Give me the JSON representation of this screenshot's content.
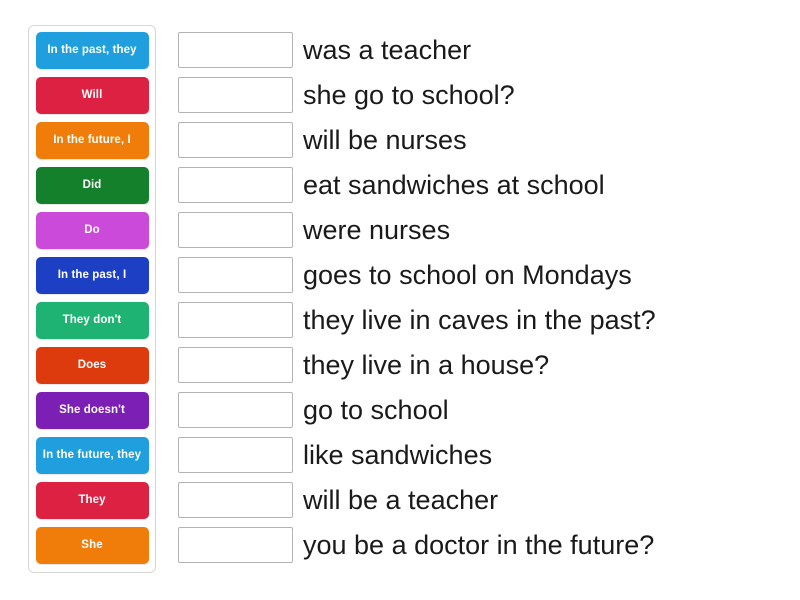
{
  "activity": {
    "type": "match-up",
    "background_color": "#ffffff"
  },
  "tiles_panel": {
    "border_color": "#d7d7d7",
    "tiles": [
      {
        "label": "In the past, they",
        "color": "#1f9fdd"
      },
      {
        "label": "Will",
        "color": "#dc2142"
      },
      {
        "label": "In the future, I",
        "color": "#f07d0a"
      },
      {
        "label": "Did",
        "color": "#14802b"
      },
      {
        "label": "Do",
        "color": "#cc4ad9"
      },
      {
        "label": "In the past, I",
        "color": "#1c3fc4"
      },
      {
        "label": "They don't",
        "color": "#1fb373"
      },
      {
        "label": "Does",
        "color": "#dd3b0e"
      },
      {
        "label": "She doesn't",
        "color": "#7b1fb5"
      },
      {
        "label": "In the future, they",
        "color": "#1f9fdd"
      },
      {
        "label": "They",
        "color": "#dc2142"
      },
      {
        "label": "She",
        "color": "#f07d0a"
      }
    ]
  },
  "rows": {
    "slot_border_color": "#b4b4b4",
    "items": [
      {
        "answer": "",
        "text": "was a teacher"
      },
      {
        "answer": "",
        "text": "she go to school?"
      },
      {
        "answer": "",
        "text": "will be nurses"
      },
      {
        "answer": "",
        "text": "eat sandwiches at school"
      },
      {
        "answer": "",
        "text": "were nurses"
      },
      {
        "answer": "",
        "text": "goes to school on Mondays"
      },
      {
        "answer": "",
        "text": "they live in caves in the past?"
      },
      {
        "answer": "",
        "text": "they live in a house?"
      },
      {
        "answer": "",
        "text": "go to school"
      },
      {
        "answer": "",
        "text": "like sandwiches"
      },
      {
        "answer": "",
        "text": "will be a teacher"
      },
      {
        "answer": "",
        "text": "you be a doctor in the future?"
      }
    ]
  }
}
